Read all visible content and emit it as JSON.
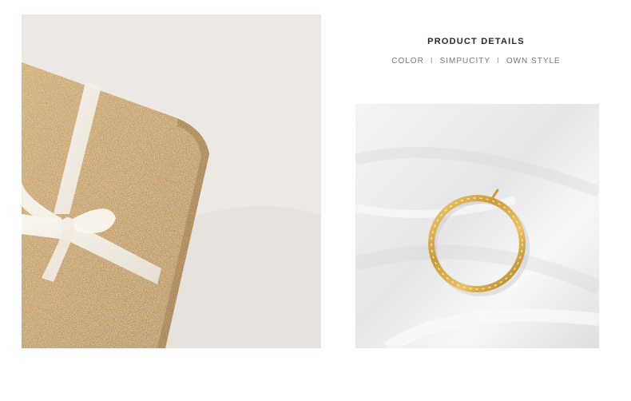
{
  "product_details": {
    "title": "PRODUCT DETAILS",
    "tags": [
      "COLOR",
      "SIMPUCITY",
      "OWN STYLE"
    ],
    "separator": "I"
  },
  "images": {
    "left": {
      "subject": "gold glitter gift box with white ribbon"
    },
    "right": {
      "subject": "gold hoop earring on white satin"
    }
  },
  "colors": {
    "gold": "#c9a35a",
    "ribbon": "#f4f1ea",
    "background": "#ffffff"
  }
}
